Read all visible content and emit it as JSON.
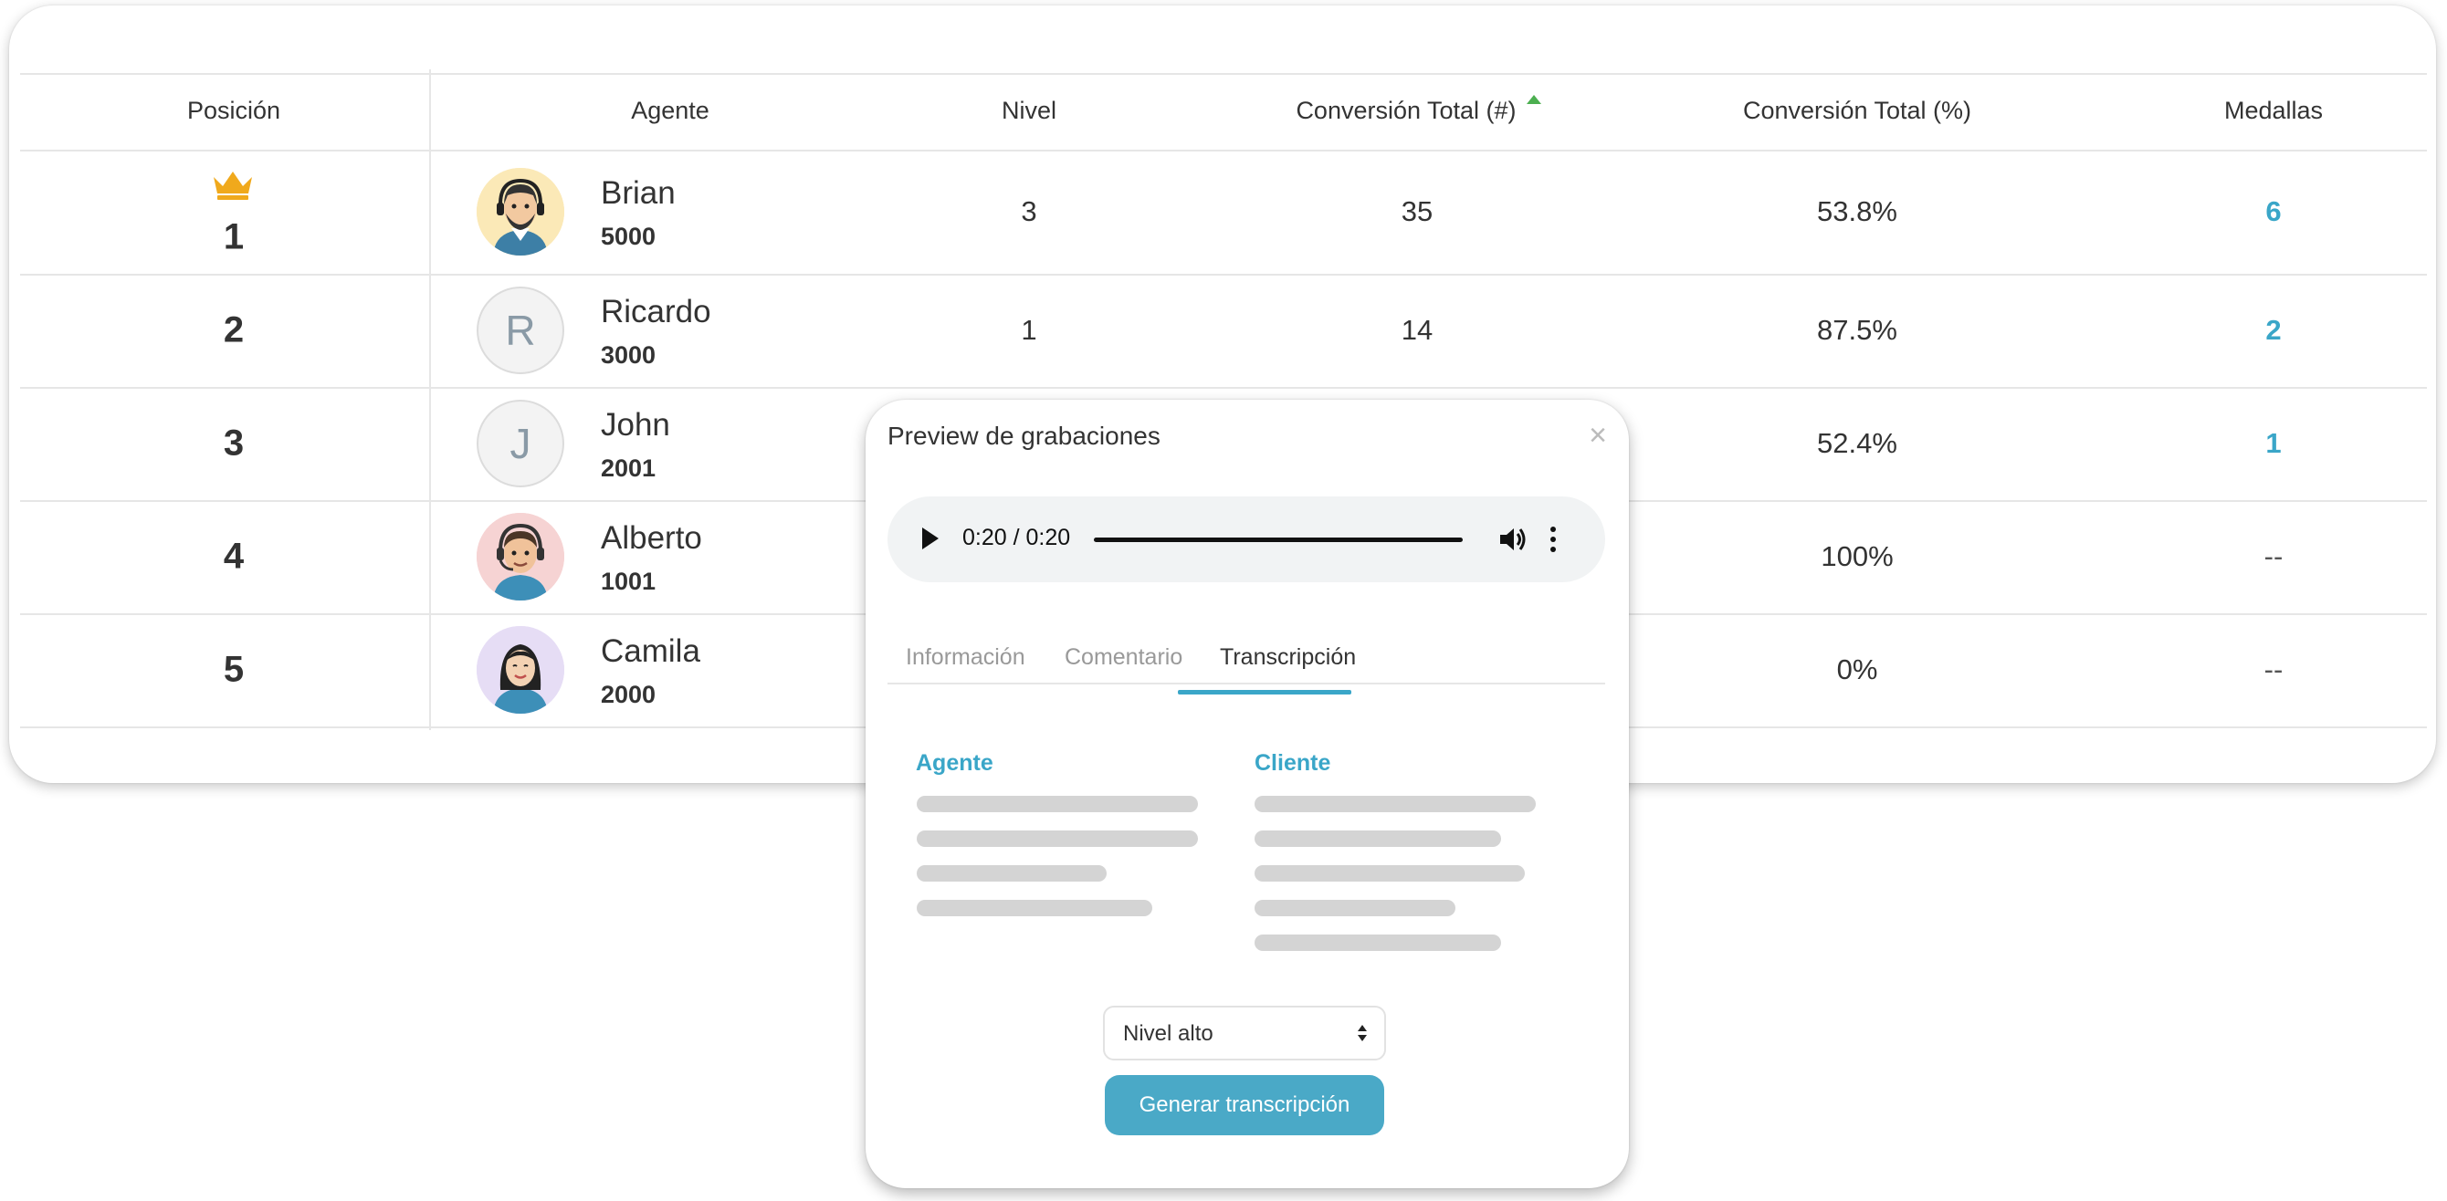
{
  "table": {
    "headers": {
      "position": "Posición",
      "agent": "Agente",
      "level": "Nivel",
      "conv_total_num": "Conversión Total (#)",
      "conv_total_pct": "Conversión Total (%)",
      "medals": "Medallas"
    },
    "sorted_column": "conv_total_num",
    "sort_direction": "ascending-icon",
    "rows": [
      {
        "position": "1",
        "name": "Brian",
        "ext": "5000",
        "avatar": "illustrated-man-headset",
        "level": "3",
        "conv_num": "35",
        "conv_pct": "53.8%",
        "medals": "6"
      },
      {
        "position": "2",
        "name": "Ricardo",
        "ext": "3000",
        "avatar_letter": "R",
        "level": "1",
        "conv_num": "14",
        "conv_pct": "87.5%",
        "medals": "2"
      },
      {
        "position": "3",
        "name": "John",
        "ext": "2001",
        "avatar_letter": "J",
        "conv_pct": "52.4%",
        "medals": "1"
      },
      {
        "position": "4",
        "name": "Alberto",
        "ext": "1001",
        "avatar": "illustrated-man-headset",
        "conv_pct": "100%",
        "medals": "--"
      },
      {
        "position": "5",
        "name": "Camila",
        "ext": "2000",
        "avatar": "illustrated-woman-headset",
        "conv_pct": "0%",
        "medals": "--"
      }
    ]
  },
  "modal": {
    "title": "Preview de grabaciones",
    "close": "×",
    "audio": {
      "time": "0:20 / 0:20",
      "progress": 1.0
    },
    "tabs": [
      {
        "label": "Información",
        "active": false
      },
      {
        "label": "Comentario",
        "active": false
      },
      {
        "label": "Transcripción",
        "active": true
      }
    ],
    "agent_label": "Agente",
    "client_label": "Cliente",
    "select_value": "Nivel alto",
    "generate_button": "Generar transcripción"
  },
  "colors": {
    "accent": "#3aa6c8",
    "button": "#4aa9c7",
    "crown": "#f0a91c",
    "sort": "#4caf50",
    "skeleton": "#d4d4d4"
  }
}
